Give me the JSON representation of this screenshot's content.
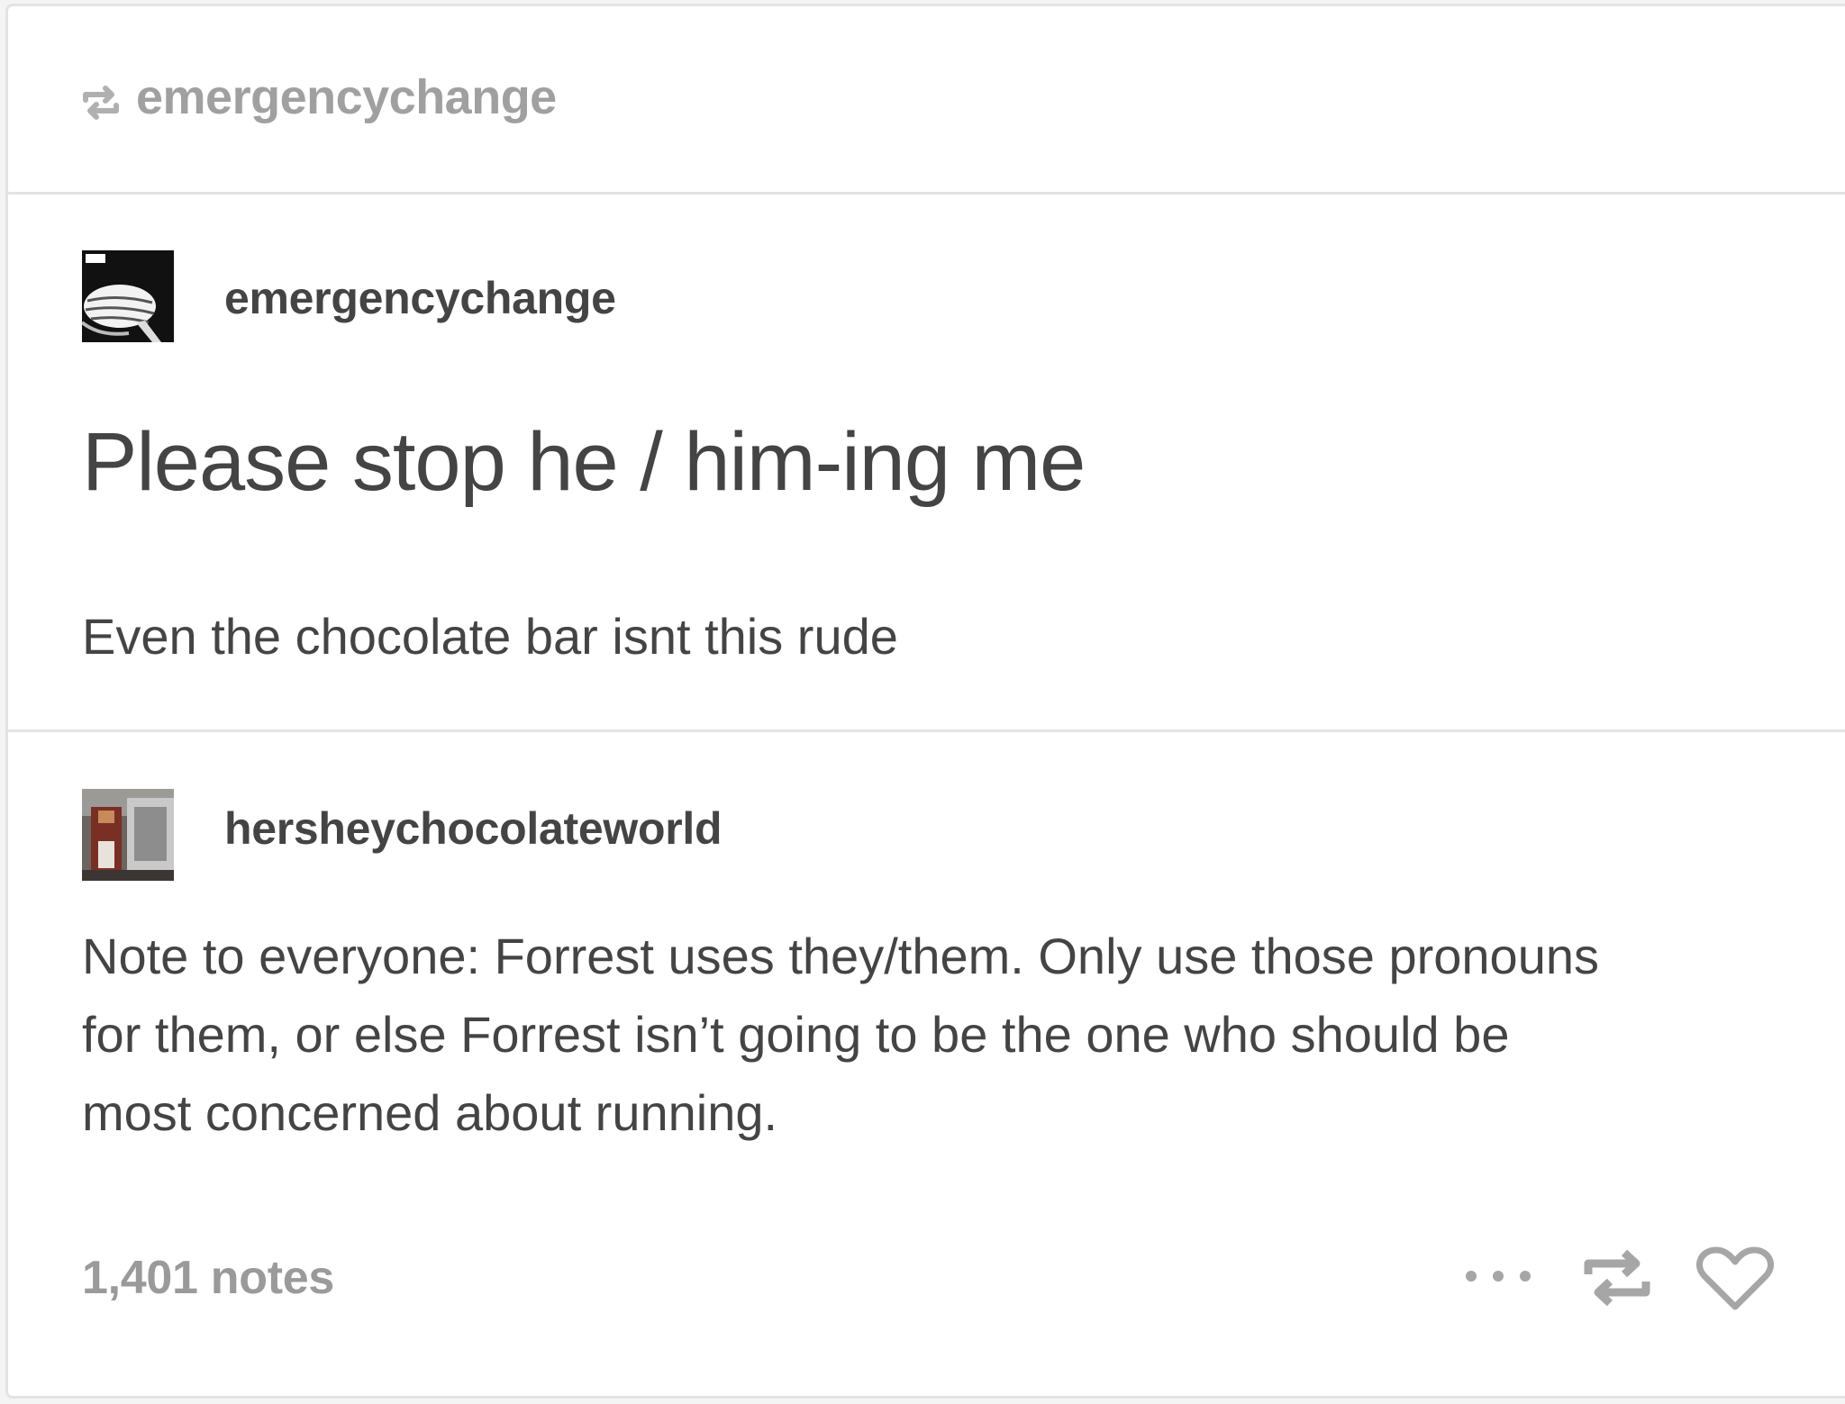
{
  "reblog_header": {
    "username": "emergencychange"
  },
  "original_post": {
    "username": "emergencychange",
    "title": "Please stop he / him-ing me",
    "body": "Even the chocolate bar isnt this rude"
  },
  "reply": {
    "username": "hersheychocolateworld",
    "body_lines": [
      "Note to everyone: Forrest uses they/them. Only use those pronouns",
      "for them, or else Forrest isn’t going to be the one who should be",
      "most concerned about running."
    ]
  },
  "footer": {
    "notes": "1,401 notes"
  },
  "icons": {
    "reblog_header_icon": "reblog-icon",
    "more": "more-options-icon",
    "reblog": "reblog-icon",
    "like": "heart-icon"
  },
  "colors": {
    "text": "#444444",
    "muted": "#9a9a9a",
    "divider": "#e3e3e3"
  }
}
